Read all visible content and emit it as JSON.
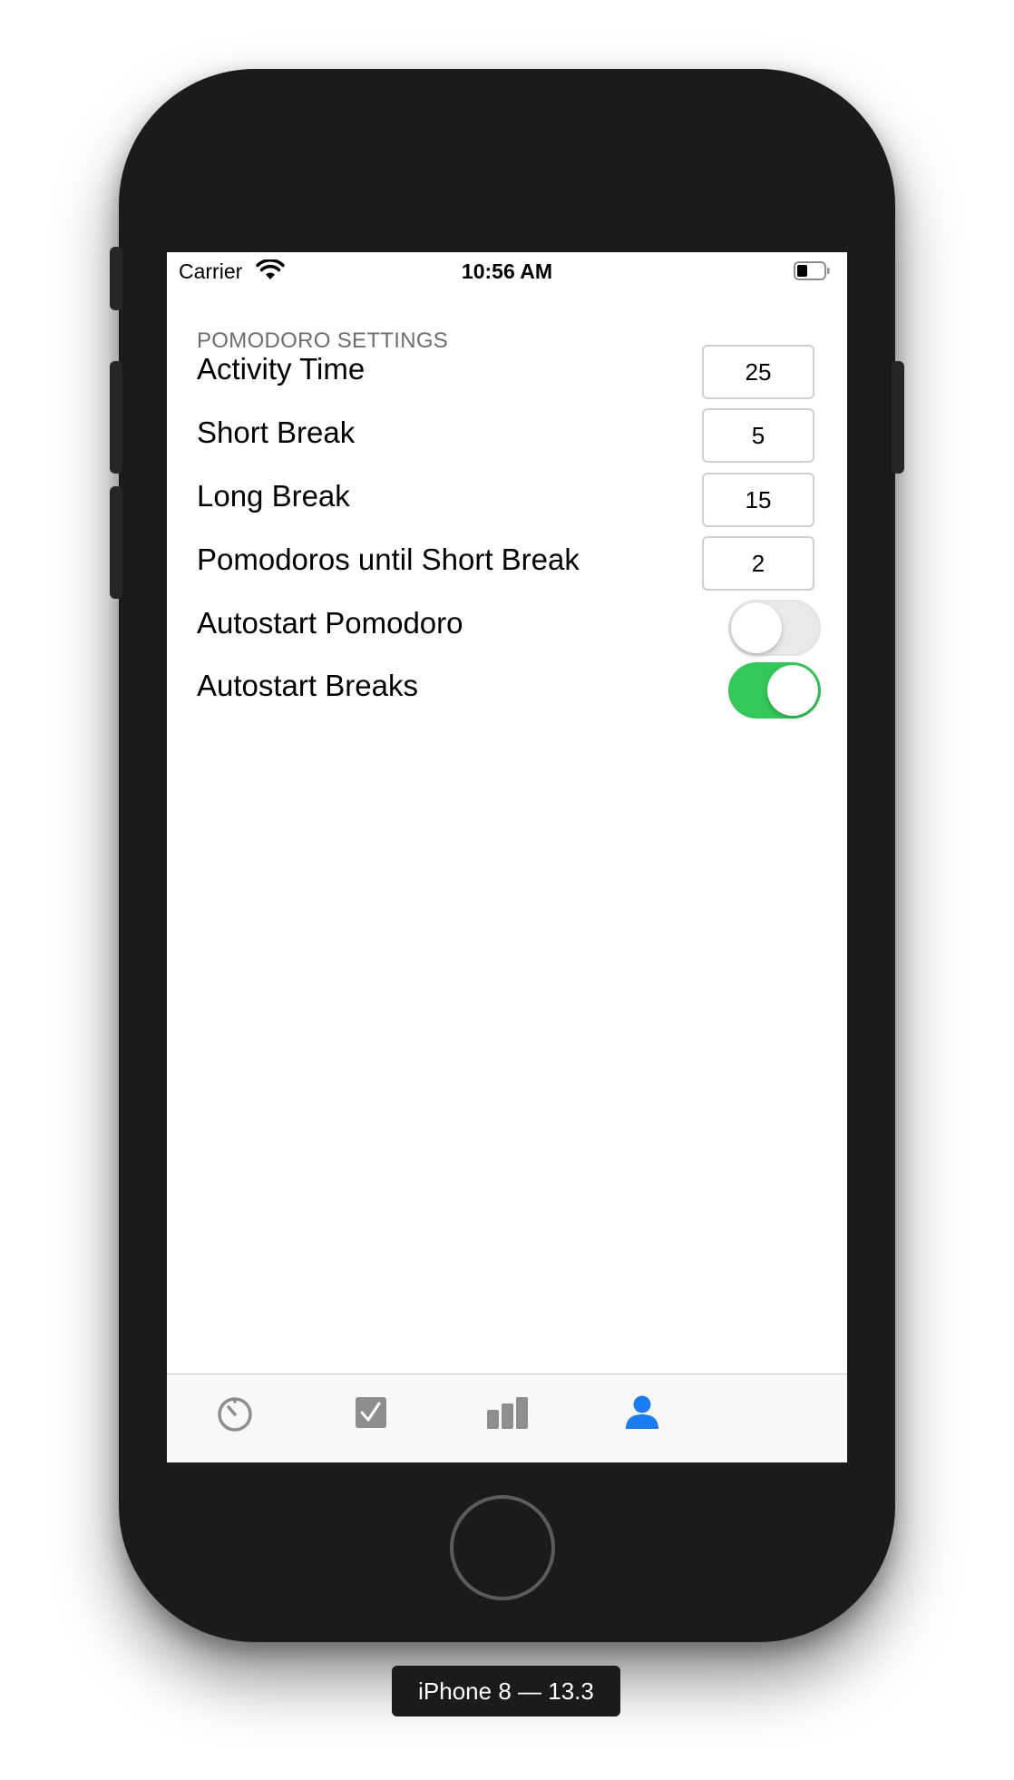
{
  "status_bar": {
    "carrier": "Carrier",
    "time": "10:56 AM"
  },
  "settings": {
    "section_header": "POMODORO SETTINGS",
    "rows": [
      {
        "label": "Activity Time",
        "value": "25"
      },
      {
        "label": "Short Break",
        "value": "5"
      },
      {
        "label": "Long Break",
        "value": "15"
      },
      {
        "label": "Pomodoros until Short Break",
        "value": "2"
      }
    ],
    "toggles": [
      {
        "label": "Autostart Pomodoro",
        "on": false
      },
      {
        "label": "Autostart Breaks",
        "on": true
      }
    ]
  },
  "tab_bar": {
    "tabs": [
      {
        "icon": "timer-icon",
        "selected": false
      },
      {
        "icon": "checkbox-icon",
        "selected": false
      },
      {
        "icon": "bar-chart-icon",
        "selected": false
      },
      {
        "icon": "person-icon",
        "selected": true
      }
    ],
    "selected_color": "#1a7cf0",
    "unselected_color": "#8e8e8e"
  },
  "colors": {
    "toggle_on": "#34c759",
    "section_header": "#6d6d72"
  },
  "device_label": "iPhone 8 — 13.3"
}
